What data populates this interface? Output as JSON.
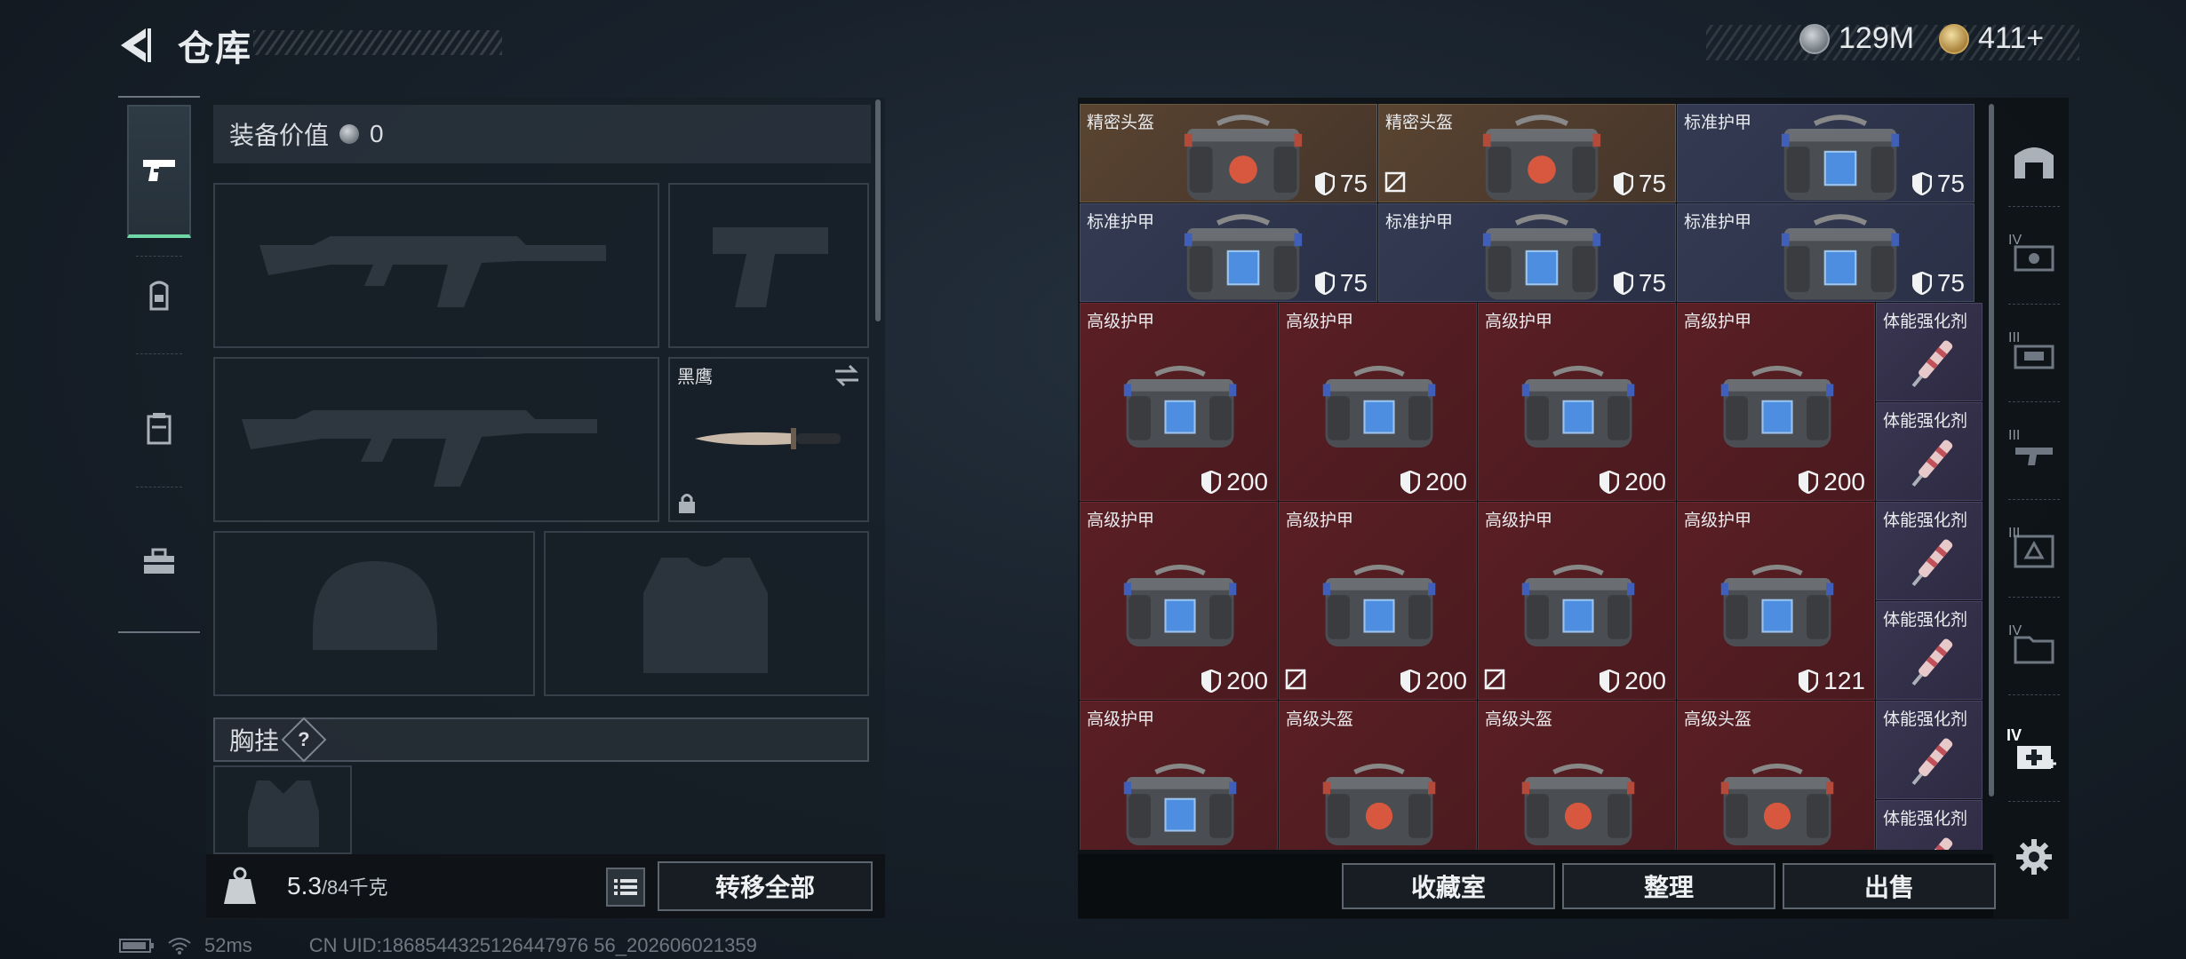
{
  "header": {
    "title": "仓库",
    "currency_silver": "129M",
    "currency_gold": "411+"
  },
  "equipment": {
    "value_label": "装备价值",
    "value_amount": "0",
    "knife_name": "黑鹰",
    "chest_rig_label": "胸挂",
    "chest_rig_help": "?",
    "weight_value": "5.3",
    "weight_capacity": "/84千克",
    "transfer_all": "转移全部"
  },
  "storage": {
    "rows": [
      [
        {
          "label": "精密头盔",
          "dur": "75",
          "tier": "gold",
          "type": "helmet-red",
          "span": 1,
          "wide": true
        },
        {
          "label": "精密头盔",
          "dur": "75",
          "tier": "gold",
          "type": "helmet-red",
          "span": 1,
          "wide": true,
          "nofix": true
        },
        {
          "label": "标准护甲",
          "dur": "75",
          "tier": "blue",
          "type": "armor-blue",
          "span": 1,
          "wide": true
        }
      ],
      [
        {
          "label": "标准护甲",
          "dur": "75",
          "tier": "blue",
          "type": "armor-blue",
          "wide": true
        },
        {
          "label": "标准护甲",
          "dur": "75",
          "tier": "blue",
          "type": "armor-blue",
          "wide": true
        },
        {
          "label": "标准护甲",
          "dur": "75",
          "tier": "blue",
          "type": "armor-blue",
          "wide": true
        }
      ]
    ],
    "big_rows": [
      [
        {
          "label": "高级护甲",
          "dur": "200",
          "type": "armor-blue"
        },
        {
          "label": "高级护甲",
          "dur": "200",
          "type": "armor-blue"
        },
        {
          "label": "高级护甲",
          "dur": "200",
          "type": "armor-blue"
        },
        {
          "label": "高级护甲",
          "dur": "200",
          "type": "armor-blue"
        }
      ],
      [
        {
          "label": "高级护甲",
          "dur": "200",
          "type": "armor-blue"
        },
        {
          "label": "高级护甲",
          "dur": "200",
          "type": "armor-blue",
          "nofix": true
        },
        {
          "label": "高级护甲",
          "dur": "200",
          "type": "armor-blue",
          "nofix": true
        },
        {
          "label": "高级护甲",
          "dur": "121",
          "type": "armor-blue"
        }
      ],
      [
        {
          "label": "高级护甲",
          "dur": "",
          "type": "armor-blue"
        },
        {
          "label": "高级头盔",
          "dur": "",
          "type": "helmet-red"
        },
        {
          "label": "高级头盔",
          "dur": "",
          "type": "helmet-red"
        },
        {
          "label": "高级头盔",
          "dur": "",
          "type": "helmet-red"
        }
      ]
    ],
    "injector_label": "体能强化剂",
    "injector_count": 6
  },
  "buttons": {
    "collection": "收藏室",
    "organize": "整理",
    "sell": "出售"
  },
  "category_tabs": [
    "IV",
    "III",
    "III",
    "III",
    "IV",
    "IV"
  ],
  "footer": {
    "ping": "52ms",
    "uid": "CN UID:1868544325126447976 56_202606021359"
  },
  "colors": {
    "accent_green": "#6fd7a6",
    "gold_tier": "#5a4431",
    "blue_tier": "#333a52",
    "red_tier": "#5a1f24"
  },
  "icons": [
    "back-arrow-icon",
    "pistol-icon",
    "backpack-icon",
    "vest-icon",
    "toolbox-icon",
    "weight-icon",
    "list-icon",
    "gear-icon",
    "shield-icon",
    "no-repair-icon",
    "swap-icon",
    "lock-icon"
  ]
}
